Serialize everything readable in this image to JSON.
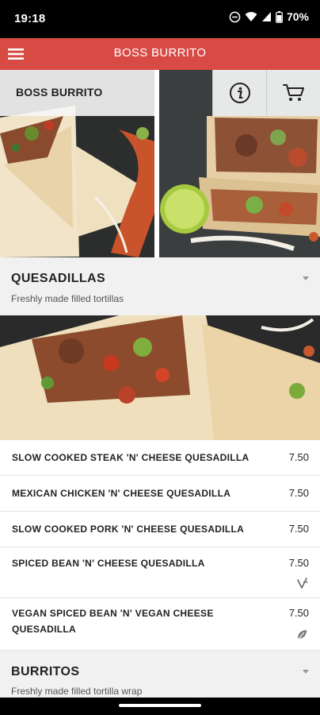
{
  "status_bar": {
    "time": "19:18",
    "battery": "70%",
    "icons": [
      "do-not-disturb-icon",
      "wifi-icon",
      "signal-icon",
      "battery-icon"
    ]
  },
  "app_bar": {
    "title": "BOSS BURRITO",
    "menu_icon": "hamburger-menu-icon",
    "color": "#d84a44"
  },
  "restaurant": {
    "name": "BOSS BURRITO",
    "info_icon": "info-icon",
    "cart_icon": "cart-icon"
  },
  "categories": [
    {
      "title": "QUESADILLAS",
      "description": "Freshly made filled tortillas",
      "items": [
        {
          "name": "SLOW COOKED STEAK 'N' CHEESE QUESADILLA",
          "price": "7.50"
        },
        {
          "name": "MEXICAN CHICKEN 'N' CHEESE QUESADILLA",
          "price": "7.50"
        },
        {
          "name": "SLOW COOKED PORK 'N' CHEESE QUESADILLA",
          "price": "7.50"
        },
        {
          "name": "SPICED BEAN 'N' CHEESE QUESADILLA",
          "price": "7.50",
          "badge": "vegetarian-icon"
        },
        {
          "name_line1": "VEGAN SPICED BEAN 'N' VEGAN CHEESE",
          "name_line2": "QUESADILLA",
          "price": "7.50",
          "badge": "vegan-leaf-icon"
        }
      ]
    },
    {
      "title": "BURRITOS",
      "description": "Freshly made filled tortilla wrap"
    }
  ]
}
